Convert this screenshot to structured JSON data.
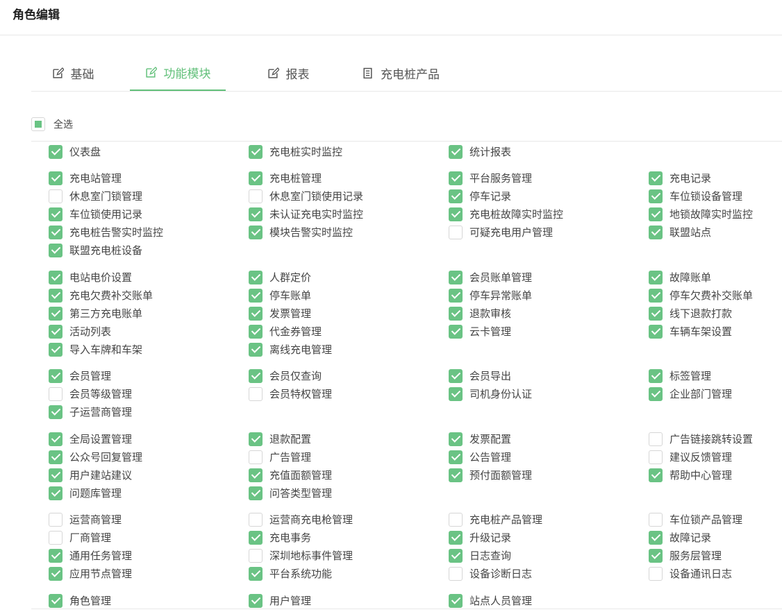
{
  "header": {
    "title": "角色编辑"
  },
  "tabs": [
    {
      "label": "基础",
      "icon": "edit-icon"
    },
    {
      "label": "功能模块",
      "icon": "edit-icon",
      "active": true
    },
    {
      "label": "报表",
      "icon": "edit-icon"
    },
    {
      "label": "充电桩产品",
      "icon": "document-icon"
    }
  ],
  "select_all": {
    "label": "全选",
    "state": "partial"
  },
  "accent_color": "#62c07a",
  "permissions": [
    {
      "label": "仪表盘",
      "checked": true
    },
    {
      "label": "充电桩实时监控",
      "checked": true
    },
    {
      "label": "统计报表",
      "checked": true
    },
    {
      "label": "充电站管理",
      "checked": true
    },
    {
      "label": "充电桩管理",
      "checked": true
    },
    {
      "label": "平台服务管理",
      "checked": true
    },
    {
      "label": "充电记录",
      "checked": true
    },
    {
      "label": "休息室门锁管理",
      "checked": false
    },
    {
      "label": "休息室门锁使用记录",
      "checked": false
    },
    {
      "label": "停车记录",
      "checked": true
    },
    {
      "label": "车位锁设备管理",
      "checked": true
    },
    {
      "label": "车位锁使用记录",
      "checked": true
    },
    {
      "label": "未认证充电实时监控",
      "checked": true
    },
    {
      "label": "充电桩故障实时监控",
      "checked": true
    },
    {
      "label": "地锁故障实时监控",
      "checked": true
    },
    {
      "label": "充电桩告警实时监控",
      "checked": true
    },
    {
      "label": "模块告警实时监控",
      "checked": true
    },
    {
      "label": "可疑充电用户管理",
      "checked": false
    },
    {
      "label": "联盟站点",
      "checked": true
    },
    {
      "label": "联盟充电桩设备",
      "checked": true
    },
    {
      "label": "电站电价设置",
      "checked": true
    },
    {
      "label": "人群定价",
      "checked": true
    },
    {
      "label": "会员账单管理",
      "checked": true
    },
    {
      "label": "故障账单",
      "checked": true
    },
    {
      "label": "充电欠费补交账单",
      "checked": true
    },
    {
      "label": "停车账单",
      "checked": true
    },
    {
      "label": "停车异常账单",
      "checked": true
    },
    {
      "label": "停车欠费补交账单",
      "checked": true
    },
    {
      "label": "第三方充电账单",
      "checked": true
    },
    {
      "label": "发票管理",
      "checked": true
    },
    {
      "label": "退款审核",
      "checked": true
    },
    {
      "label": "线下退款打款",
      "checked": true
    },
    {
      "label": "活动列表",
      "checked": true
    },
    {
      "label": "代金券管理",
      "checked": true
    },
    {
      "label": "云卡管理",
      "checked": true
    },
    {
      "label": "车辆车架设置",
      "checked": true
    },
    {
      "label": "导入车牌和车架",
      "checked": true
    },
    {
      "label": "离线充电管理",
      "checked": true
    },
    {
      "label": "会员管理",
      "checked": true
    },
    {
      "label": "会员仅查询",
      "checked": true
    },
    {
      "label": "会员导出",
      "checked": true
    },
    {
      "label": "标签管理",
      "checked": true
    },
    {
      "label": "会员等级管理",
      "checked": false
    },
    {
      "label": "会员特权管理",
      "checked": false
    },
    {
      "label": "司机身份认证",
      "checked": true
    },
    {
      "label": "企业部门管理",
      "checked": true
    },
    {
      "label": "子运营商管理",
      "checked": true
    },
    {
      "label": "全局设置管理",
      "checked": true
    },
    {
      "label": "退款配置",
      "checked": true
    },
    {
      "label": "发票配置",
      "checked": true
    },
    {
      "label": "广告链接跳转设置",
      "checked": false
    },
    {
      "label": "公众号回复管理",
      "checked": true
    },
    {
      "label": "广告管理",
      "checked": false
    },
    {
      "label": "公告管理",
      "checked": true
    },
    {
      "label": "建议反馈管理",
      "checked": false
    },
    {
      "label": "用户建站建议",
      "checked": true
    },
    {
      "label": "充值面额管理",
      "checked": true
    },
    {
      "label": "预付面额管理",
      "checked": true
    },
    {
      "label": "帮助中心管理",
      "checked": true
    },
    {
      "label": "问题库管理",
      "checked": true
    },
    {
      "label": "问答类型管理",
      "checked": true
    },
    {
      "label": "运营商管理",
      "checked": false
    },
    {
      "label": "运营商充电枪管理",
      "checked": false
    },
    {
      "label": "充电桩产品管理",
      "checked": false
    },
    {
      "label": "车位锁产品管理",
      "checked": false
    },
    {
      "label": "厂商管理",
      "checked": false
    },
    {
      "label": "充电事务",
      "checked": true
    },
    {
      "label": "升级记录",
      "checked": true
    },
    {
      "label": "故障记录",
      "checked": true
    },
    {
      "label": "通用任务管理",
      "checked": true
    },
    {
      "label": "深圳地标事件管理",
      "checked": false
    },
    {
      "label": "日志查询",
      "checked": true
    },
    {
      "label": "服务层管理",
      "checked": true
    },
    {
      "label": "应用节点管理",
      "checked": true
    },
    {
      "label": "平台系统功能",
      "checked": true
    },
    {
      "label": "设备诊断日志",
      "checked": false
    },
    {
      "label": "设备通讯日志",
      "checked": false
    },
    {
      "label": "角色管理",
      "checked": true
    },
    {
      "label": "用户管理",
      "checked": true
    },
    {
      "label": "站点人员管理",
      "checked": true
    }
  ]
}
